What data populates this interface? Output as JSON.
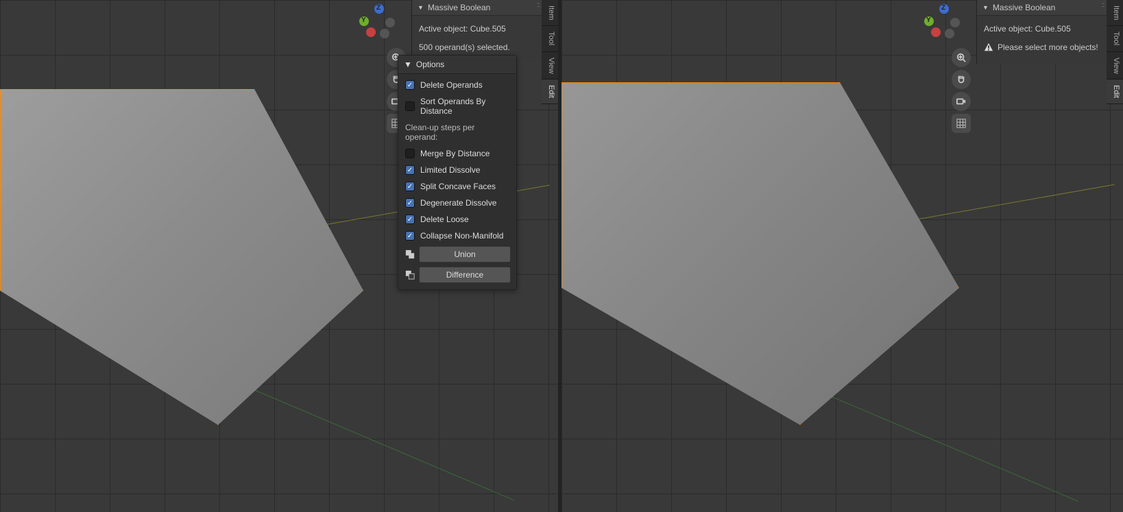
{
  "panel": {
    "title": "Massive Boolean",
    "active_object_label": "Active object: Cube.505",
    "operands_selected": "500 operand(s) selected.",
    "warning": "Please select more objects!"
  },
  "options": {
    "header": "Options",
    "delete_operands": {
      "label": "Delete Operands",
      "checked": true
    },
    "sort_by_distance": {
      "label": "Sort Operands By Distance",
      "checked": false
    },
    "cleanup_label": "Clean-up steps per operand:",
    "merge_by_distance": {
      "label": "Merge By Distance",
      "checked": false
    },
    "limited_dissolve": {
      "label": "Limited Dissolve",
      "checked": true
    },
    "split_concave": {
      "label": "Split Concave Faces",
      "checked": true
    },
    "degenerate_dissolve": {
      "label": "Degenerate Dissolve",
      "checked": true
    },
    "delete_loose": {
      "label": "Delete Loose",
      "checked": true
    },
    "collapse_non_manifold": {
      "label": "Collapse Non-Manifold",
      "checked": true
    }
  },
  "buttons": {
    "union": "Union",
    "difference": "Difference"
  },
  "tabs": {
    "item": "Item",
    "tool": "Tool",
    "view": "View",
    "edit": "Edit"
  },
  "gizmo": {
    "x": "X",
    "y": "Y",
    "z": "Z"
  }
}
